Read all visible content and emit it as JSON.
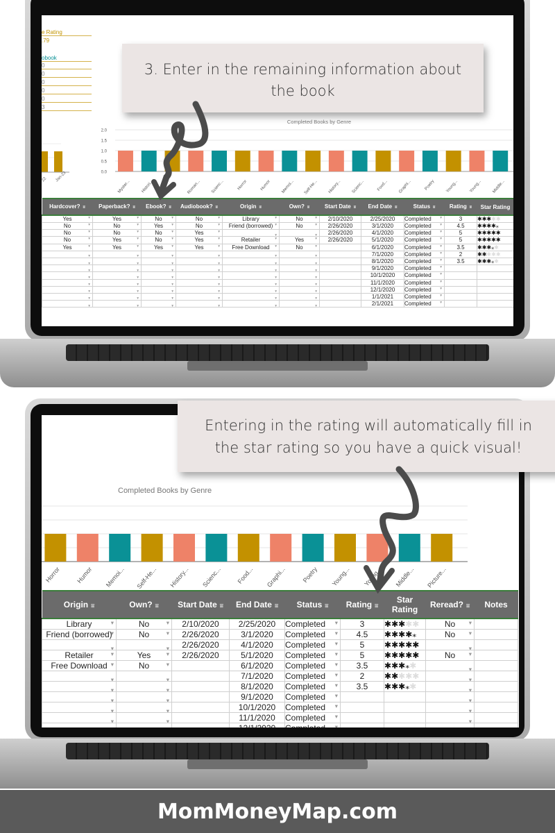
{
  "top_panel": {
    "callout": "3. Enter in the remaining information about the book",
    "summary": {
      "rating_label": "e Rating",
      "rating_value": ".79",
      "audiobook_label": "obook",
      "audiobook_values": [
        "0",
        "0",
        "0",
        "0",
        "0",
        "3"
      ],
      "mini_chart_labels": [
        "22",
        "Jan-23"
      ]
    },
    "columns": [
      "Hardcover?",
      "Paperback?",
      "Ebook?",
      "Audiobook?",
      "Origin",
      "Own?",
      "Start Date",
      "End Date",
      "Status",
      "Rating",
      "Star Rating"
    ]
  },
  "bottom_panel": {
    "callout": "Entering in the rating will automatically fill in the star rating so you have a quick visual!",
    "columns": [
      "Origin",
      "Own?",
      "Start Date",
      "End Date",
      "Status",
      "Rating",
      "Star Rating",
      "Reread?",
      "Notes"
    ]
  },
  "rows": [
    {
      "hardcover": "Yes",
      "paperback": "Yes",
      "ebook": "No",
      "audiobook": "No",
      "origin": "Library",
      "own": "No",
      "start": "2/10/2020",
      "end": "2/25/2020",
      "status": "Completed",
      "rating": 3,
      "reread": "No"
    },
    {
      "hardcover": "No",
      "paperback": "No",
      "ebook": "Yes",
      "audiobook": "No",
      "origin": "Friend (borrowed)",
      "own": "No",
      "start": "2/26/2020",
      "end": "3/1/2020",
      "status": "Completed",
      "rating": 4.5,
      "reread": "No"
    },
    {
      "hardcover": "No",
      "paperback": "No",
      "ebook": "No",
      "audiobook": "Yes",
      "origin": "",
      "own": "",
      "start": "2/26/2020",
      "end": "4/1/2020",
      "status": "Completed",
      "rating": 5,
      "reread": ""
    },
    {
      "hardcover": "No",
      "paperback": "Yes",
      "ebook": "No",
      "audiobook": "Yes",
      "origin": "Retailer",
      "own": "Yes",
      "start": "2/26/2020",
      "end": "5/1/2020",
      "status": "Completed",
      "rating": 5,
      "reread": "No"
    },
    {
      "hardcover": "Yes",
      "paperback": "Yes",
      "ebook": "Yes",
      "audiobook": "Yes",
      "origin": "Free Download",
      "own": "No",
      "start": "",
      "end": "6/1/2020",
      "status": "Completed",
      "rating": 3.5,
      "reread": ""
    },
    {
      "hardcover": "",
      "paperback": "",
      "ebook": "",
      "audiobook": "",
      "origin": "",
      "own": "",
      "start": "",
      "end": "7/1/2020",
      "status": "Completed",
      "rating": 2,
      "reread": ""
    },
    {
      "hardcover": "",
      "paperback": "",
      "ebook": "",
      "audiobook": "",
      "origin": "",
      "own": "",
      "start": "",
      "end": "8/1/2020",
      "status": "Completed",
      "rating": 3.5,
      "reread": ""
    },
    {
      "hardcover": "",
      "paperback": "",
      "ebook": "",
      "audiobook": "",
      "origin": "",
      "own": "",
      "start": "",
      "end": "9/1/2020",
      "status": "Completed",
      "rating": null,
      "reread": ""
    },
    {
      "hardcover": "",
      "paperback": "",
      "ebook": "",
      "audiobook": "",
      "origin": "",
      "own": "",
      "start": "",
      "end": "10/1/2020",
      "status": "Completed",
      "rating": null,
      "reread": ""
    },
    {
      "hardcover": "",
      "paperback": "",
      "ebook": "",
      "audiobook": "",
      "origin": "",
      "own": "",
      "start": "",
      "end": "11/1/2020",
      "status": "Completed",
      "rating": null,
      "reread": ""
    },
    {
      "hardcover": "",
      "paperback": "",
      "ebook": "",
      "audiobook": "",
      "origin": "",
      "own": "",
      "start": "",
      "end": "12/1/2020",
      "status": "Completed",
      "rating": null,
      "reread": ""
    },
    {
      "hardcover": "",
      "paperback": "",
      "ebook": "",
      "audiobook": "",
      "origin": "",
      "own": "",
      "start": "",
      "end": "1/1/2021",
      "status": "Completed",
      "rating": null,
      "reread": ""
    },
    {
      "hardcover": "",
      "paperback": "",
      "ebook": "",
      "audiobook": "",
      "origin": "",
      "own": "",
      "start": "",
      "end": "2/1/2021",
      "status": "Completed",
      "rating": null,
      "reread": ""
    }
  ],
  "chart_data": {
    "type": "bar",
    "title": "Completed Books by Genre",
    "categories": [
      "Myster...",
      "Histori...",
      "",
      "Roman...",
      "Scienc...",
      "Horror",
      "Humor",
      "Memoi...",
      "Self-He...",
      "History...",
      "Scienc...",
      "Food...",
      "Graphi...",
      "Poetry",
      "Young...",
      "Young...",
      "Middle...",
      "Picture..."
    ],
    "values": [
      1,
      1,
      1,
      1,
      1,
      1,
      1,
      1,
      1,
      1,
      1,
      1,
      1,
      1,
      1,
      1,
      1,
      1
    ],
    "yticks": [
      "0.0",
      "0.5",
      "1.0",
      "1.5",
      "2.0"
    ],
    "ylim": [
      0,
      2
    ],
    "grid": true,
    "colors": [
      "#ee8268",
      "#0a9196",
      "#c39100"
    ]
  },
  "footer": {
    "brand": "MomMoneyMap.com",
    "background": "#5a5a5a"
  }
}
